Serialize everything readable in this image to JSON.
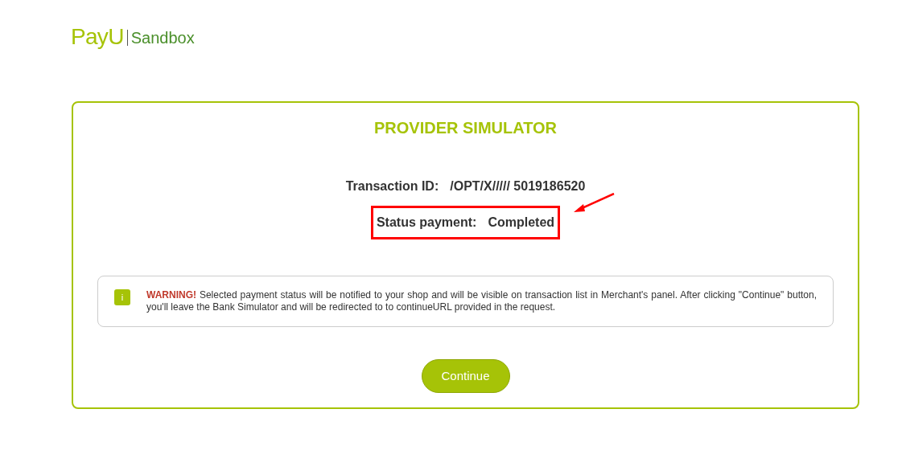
{
  "logo": {
    "brand": "PayU",
    "environment": "Sandbox"
  },
  "card": {
    "title": "PROVIDER SIMULATOR",
    "fields": [
      {
        "label": "Transaction ID:",
        "value": "/OPT/X///// 5019186520",
        "highlighted": false
      },
      {
        "label": "Status payment:",
        "value": "Completed",
        "highlighted": true
      }
    ],
    "notice": {
      "icon": "i",
      "text": "**WARNING!** Selected payment status will be notified to your shop and will be visible on transaction list in Merchant's panel. After clicking \"Continue\" button, you'll leave the Bank Simulator and will be redirected to to continueURL provided in the request."
    },
    "button": "Continue"
  }
}
